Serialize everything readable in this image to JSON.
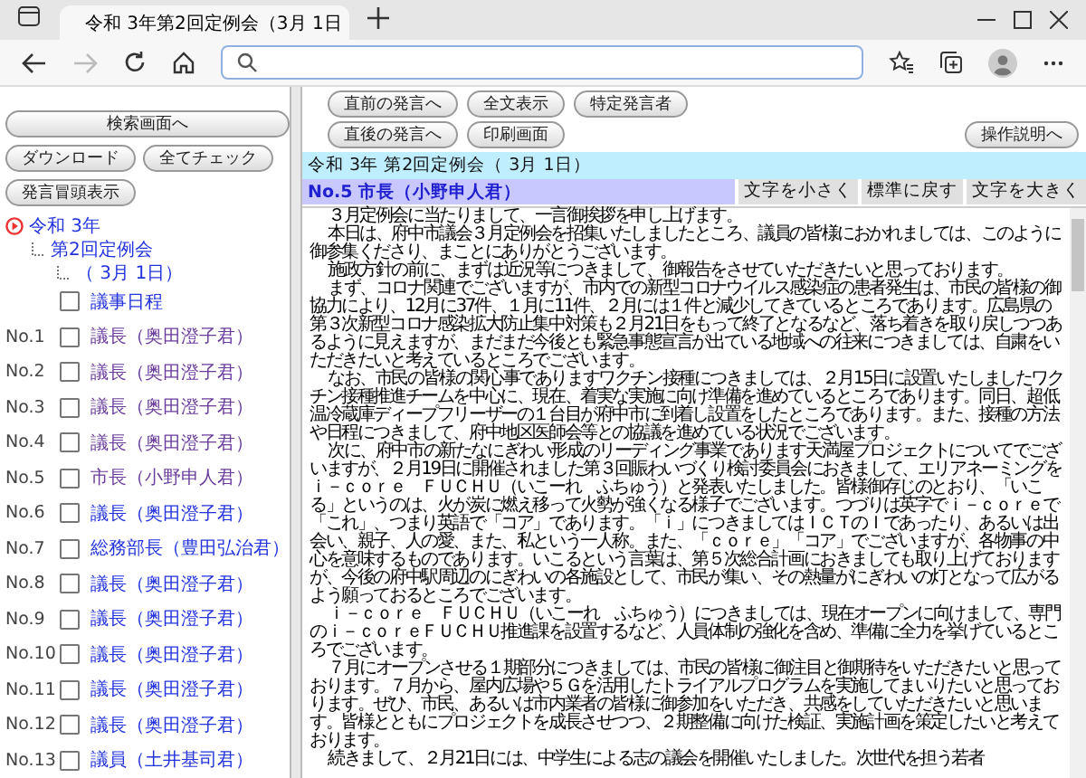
{
  "browser": {
    "tab_title": "令和 3年第2回定例会（3月 1日"
  },
  "left_pane": {
    "search_button": "検索画面へ",
    "buttons": [
      "ダウンロード",
      "全てチェック"
    ],
    "preview_button": "発言冒頭表示",
    "tree": {
      "label": "令和 3年",
      "children": [
        {
          "label": "第2回定例会",
          "children": [
            {
              "label": "（ 3月 1日）"
            }
          ]
        }
      ]
    },
    "items": [
      {
        "label": "議事日程",
        "checked": false,
        "visited": false
      },
      {
        "number": "No.1",
        "label": "議長（奥田澄子君）",
        "checked": false,
        "visited": true
      },
      {
        "number": "No.2",
        "label": "議長（奥田澄子君）",
        "checked": false,
        "visited": true
      },
      {
        "number": "No.3",
        "label": "議長（奥田澄子君）",
        "checked": false,
        "visited": true
      },
      {
        "number": "No.4",
        "label": "議長（奥田澄子君）",
        "checked": false,
        "visited": true
      },
      {
        "number": "No.5",
        "label": "市長（小野申人君）",
        "checked": false,
        "visited": true
      },
      {
        "number": "No.6",
        "label": "議長（奥田澄子君）",
        "checked": false,
        "visited": false
      },
      {
        "number": "No.7",
        "label": "総務部長（豊田弘治君）",
        "checked": false,
        "visited": false
      },
      {
        "number": "No.8",
        "label": "議長（奥田澄子君）",
        "checked": false,
        "visited": false
      },
      {
        "number": "No.9",
        "label": "議長（奥田澄子君）",
        "checked": false,
        "visited": false
      },
      {
        "number": "No.10",
        "label": "議長（奥田澄子君）",
        "checked": false,
        "visited": false
      },
      {
        "number": "No.11",
        "label": "議長（奥田澄子君）",
        "checked": false,
        "visited": false
      },
      {
        "number": "No.12",
        "label": "議長（奥田澄子君）",
        "checked": false,
        "visited": false
      },
      {
        "number": "No.13",
        "label": "議員（土井基司君）",
        "checked": false,
        "visited": false
      }
    ]
  },
  "right_pane": {
    "nav_buttons": [
      [
        "直前の発言へ",
        "全文表示",
        "特定発言者"
      ],
      [
        "直後の発言へ",
        "印刷画面"
      ]
    ],
    "help_button": "操作説明へ",
    "meeting_title": "令和 3年 第2回定例会（ 3月 1日）",
    "speaker": "No.5 市長（小野申人君）",
    "font_buttons": [
      "文字を小さく",
      "標準に戻す",
      "文字を大きく"
    ],
    "paragraphs": [
      "３月定例会に当たりまして、一言御挨拶を申し上げます。",
      "本日は、府中市議会３月定例会を招集いたしましたところ、議員の皆様におかれましては、このように御参集くださり、まことにありがとうございます。",
      "施政方針の前に、まずは近況等につきまして、御報告をさせていただきたいと思っております。",
      "まず、コロナ関連でございますが、市内での新型コロナウイルス感染症の患者発生は、市民の皆様の御協力により、12月に37件、１月に11件、２月には１件と減少してきているところであります。広島県の第３次新型コロナ感染拡大防止集中対策も２月21日をもって終了となるなど、落ち着きを取り戻しつつあるように見えますが、まだまだ今後とも緊急事態宣言が出ている地域への往来につきましては、自粛をいただきたいと考えているところでございます。",
      "なお、市民の皆様の関心事でありますワクチン接種につきましては、２月15日に設置いたしましたワクチン接種推進チームを中心に、現在、着実な実施に向け準備を進めているところであります。同日、超低温冷蔵庫ディープフリーザーの１台目が府中市に到着し設置をしたところであります。また、接種の方法や日程につきまして、府中地区医師会等との協議を進めている状況でございます。",
      "次に、府中市の新たなにぎわい形成のリーディング事業であります天満屋プロジェクトについてでございますが、２月19日に開催されました第３回賑わいづくり検討委員会におきまして、エリアネーミングをｉ－ｃｏｒｅ　ＦＵＣＨＵ（いこーれ　ふちゅう）と発表いたしました。皆様御存じのとおり、「いこる」というのは、火が炭に燃え移って火勢が強くなる様子でございます。つづりは英字でｉ－ｃｏｒｅで「これ」、つまり英語で「コア」であります。「ｉ」につきましてはＩＣＴのＩであったり、あるいは出会い、親子、人の愛、また、私という一人称。また、「ｃｏｒｅ」「コア」でございますが、各物事の中心を意味するものであります。いこるという言葉は、第５次総合計画におきましても取り上げておりますが、今後の府中駅周辺のにぎわいの各施設として、市民が集い、その熱量がにぎわいの灯となって広がるよう願っておるところでございます。",
      "ｉ－ｃｏｒｅ　ＦＵＣＨＵ（いこーれ　ふちゅう）につきましては、現在オープンに向けまして、専門のｉ－ｃｏｒｅＦＵＣＨＵ推進課を設置するなど、人員体制の強化を含め、準備に全力を挙げているところでございます。",
      "７月にオープンさせる１期部分につきましては、市民の皆様に御注目と御期待をいただきたいと思っております。７月から、屋内広場や５Ｇを活用したトライアルプログラムを実施してまいりたいと思っております。ぜひ、市民、あるいは市内業者の皆様に御参加をいただき、共感をしていただきたいと思います。皆様とともにプロジェクトを成長させつつ、２期整備に向けた検証、実施計画を策定したいと考えております。",
      "続きまして、２月21日には、中学生による志の議会を開催いたしました。次世代を担う若者"
    ]
  }
}
